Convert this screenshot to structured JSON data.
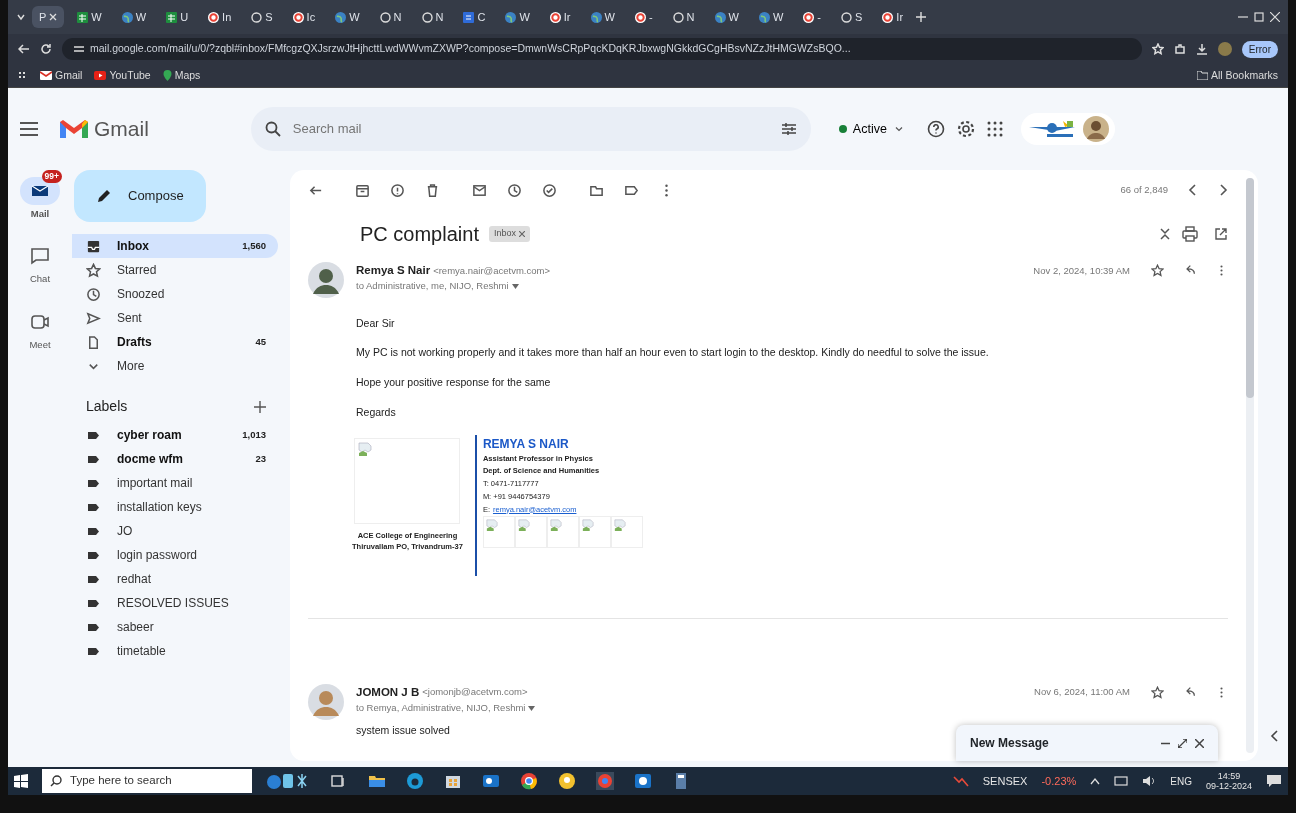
{
  "browser": {
    "tabs": [
      {
        "title": "P",
        "kind": "blank",
        "selected": true
      },
      {
        "title": "W",
        "kind": "sheet",
        "selected": false
      },
      {
        "title": "W",
        "kind": "globe",
        "selected": false
      },
      {
        "title": "U",
        "kind": "sheet",
        "selected": false
      },
      {
        "title": "In",
        "kind": "google",
        "selected": false
      },
      {
        "title": "S",
        "kind": "github",
        "selected": false
      },
      {
        "title": "Ic",
        "kind": "google",
        "selected": false
      },
      {
        "title": "W",
        "kind": "globe",
        "selected": false
      },
      {
        "title": "N",
        "kind": "github",
        "selected": false
      },
      {
        "title": "N",
        "kind": "github",
        "selected": false
      },
      {
        "title": "C",
        "kind": "docs",
        "selected": false
      },
      {
        "title": "W",
        "kind": "globe",
        "selected": false
      },
      {
        "title": "Ir",
        "kind": "google",
        "selected": false
      },
      {
        "title": "W",
        "kind": "globe",
        "selected": false
      },
      {
        "title": "-",
        "kind": "google",
        "selected": false
      },
      {
        "title": "N",
        "kind": "github",
        "selected": false
      },
      {
        "title": "W",
        "kind": "globe",
        "selected": false
      },
      {
        "title": "W",
        "kind": "globe",
        "selected": false
      },
      {
        "title": "-",
        "kind": "google",
        "selected": false
      },
      {
        "title": "S",
        "kind": "github",
        "selected": false
      },
      {
        "title": "Ir",
        "kind": "google",
        "selected": false
      }
    ],
    "address": "mail.google.com/mail/u/0/?zqbl#inbox/FMfcgzQXJsrzwJtHjhcttLwdWWvmZXWP?compose=DmwnWsCRpPqcKDqKRJbxwgNGkkdGCgHBsvNZzJtHMGWZsBQO...",
    "profile": "Error",
    "bookmarks": [
      {
        "label": "Gmail",
        "kind": "gmail"
      },
      {
        "label": "YouTube",
        "kind": "youtube"
      },
      {
        "label": "Maps",
        "kind": "maps"
      }
    ],
    "all_bookmarks": "All Bookmarks"
  },
  "header": {
    "logo": "Gmail",
    "search_placeholder": "Search mail",
    "status": "Active"
  },
  "rail": [
    {
      "label": "Mail",
      "badge": "99+",
      "kind": "mail",
      "selected": true
    },
    {
      "label": "Chat",
      "kind": "chat",
      "selected": false
    },
    {
      "label": "Meet",
      "kind": "meet",
      "selected": false
    }
  ],
  "compose": "Compose",
  "folders": [
    {
      "label": "Inbox",
      "count": "1,560",
      "kind": "inbox",
      "unread": true,
      "selected": true
    },
    {
      "label": "Starred",
      "kind": "star",
      "unread": false,
      "selected": false
    },
    {
      "label": "Snoozed",
      "kind": "clock",
      "unread": false,
      "selected": false
    },
    {
      "label": "Sent",
      "kind": "send",
      "unread": false,
      "selected": false
    },
    {
      "label": "Drafts",
      "count": "45",
      "kind": "draft",
      "unread": true,
      "selected": false
    },
    {
      "label": "More",
      "kind": "more",
      "unread": false,
      "selected": false
    }
  ],
  "labels_title": "Labels",
  "labels": [
    {
      "name": "cyber roam",
      "count": "1,013",
      "unread": true
    },
    {
      "name": "docme wfm",
      "count": "23",
      "unread": true
    },
    {
      "name": "important mail",
      "unread": false
    },
    {
      "name": "installation keys",
      "unread": false
    },
    {
      "name": "JO",
      "unread": false
    },
    {
      "name": "login password",
      "unread": false
    },
    {
      "name": "redhat",
      "unread": false
    },
    {
      "name": "RESOLVED ISSUES",
      "unread": false
    },
    {
      "name": "sabeer",
      "unread": false
    },
    {
      "name": "timetable",
      "unread": false
    }
  ],
  "toolbar": {
    "position": "66 of 2,849"
  },
  "thread": {
    "subject": "PC complaint",
    "tag": "Inbox",
    "messages": [
      {
        "sender": "Remya S Nair",
        "email": "<remya.nair@acetvm.com>",
        "to": "to Administrative, me, NIJO, Reshmi",
        "date": "Nov 2, 2024, 10:39 AM",
        "body": [
          "Dear Sir",
          "My PC is not working properly and it takes more than half an hour  even to start login to the desktop.  Kindly do needful to solve the issue.",
          "Hope your positive response for the same",
          "Regards"
        ],
        "signature": {
          "college": "ACE College of Engineering",
          "address": "Thiruvallam PO, Trivandrum-37",
          "name": "REMYA S NAIR",
          "lines": [
            "Assistant Professor in Physics",
            "Dept. of Science and Humanities",
            "T: 0471-7117777",
            "M: +91 9446754379"
          ],
          "email_label": "E:",
          "email": "remya.nair@acetvm.com"
        }
      },
      {
        "sender": "JOMON J B",
        "email": "<jomonjb@acetvm.com>",
        "to": "to Remya, Administrative, NIJO, Reshmi",
        "date": "Nov 6, 2024, 11:00 AM",
        "body": [
          "system issue solved"
        ]
      }
    ]
  },
  "compose_window": {
    "title": "New Message"
  },
  "taskbar": {
    "search_placeholder": "Type here to search",
    "ticker": "SENSEX",
    "change": "-0.23%",
    "language": "ENG",
    "time": "14:59",
    "date": "09-12-2024"
  }
}
